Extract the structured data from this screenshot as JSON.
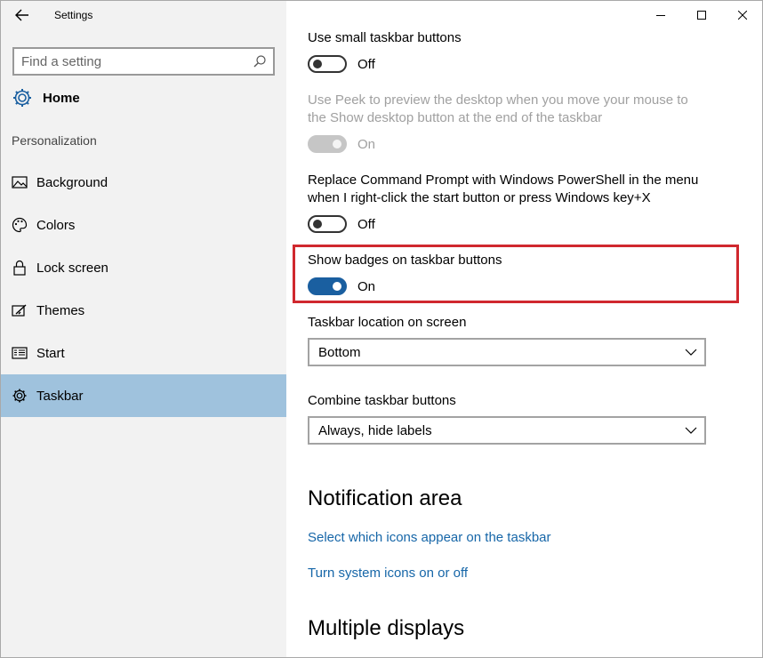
{
  "window": {
    "title": "Settings",
    "controls": {
      "minimize": "minimize",
      "maximize": "maximize",
      "close": "close"
    }
  },
  "sidebar": {
    "search_placeholder": "Find a setting",
    "home_label": "Home",
    "section_label": "Personalization",
    "items": [
      {
        "label": "Background",
        "icon": "picture-icon"
      },
      {
        "label": "Colors",
        "icon": "palette-icon"
      },
      {
        "label": "Lock screen",
        "icon": "lock-icon"
      },
      {
        "label": "Themes",
        "icon": "themes-icon"
      },
      {
        "label": "Start",
        "icon": "start-icon"
      },
      {
        "label": "Taskbar",
        "icon": "gear-icon",
        "selected": true
      }
    ]
  },
  "content": {
    "settings": [
      {
        "title": "Use small taskbar buttons",
        "state": "Off",
        "enabled": true
      },
      {
        "title_line1": "Use Peek to preview the desktop when you move your mouse to",
        "title_line2": "the Show desktop button at the end of the taskbar",
        "state": "On",
        "enabled": false
      },
      {
        "title_line1": "Replace Command Prompt with Windows PowerShell in the menu",
        "title_line2": "when I right-click the start button or press Windows key+X",
        "state": "Off",
        "enabled": true
      },
      {
        "title": "Show badges on taskbar buttons",
        "state": "On",
        "enabled": true,
        "highlighted": true
      }
    ],
    "taskbar_location": {
      "label": "Taskbar location on screen",
      "value": "Bottom"
    },
    "combine_buttons": {
      "label": "Combine taskbar buttons",
      "value": "Always, hide labels"
    },
    "notification_area": {
      "heading": "Notification area",
      "links": [
        "Select which icons appear on the taskbar",
        "Turn system icons on or off"
      ]
    },
    "multiple_displays": {
      "heading": "Multiple displays"
    }
  },
  "colors": {
    "accent": "#1a5fa0",
    "link": "#1666a8",
    "selected_nav": "#9fc2dd",
    "highlight_border": "#d0282e"
  }
}
